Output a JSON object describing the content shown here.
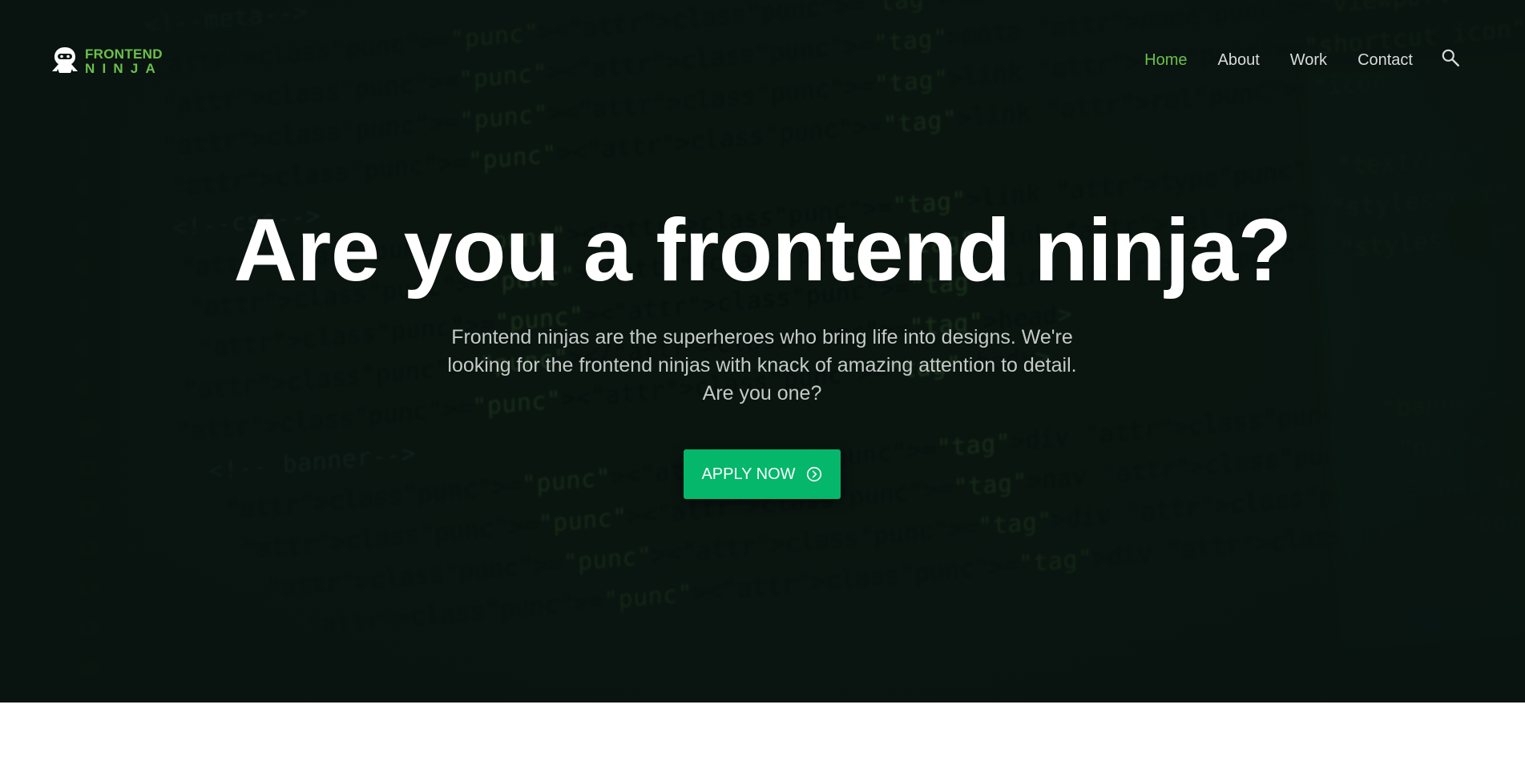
{
  "brand": {
    "line1": "FRONTEND",
    "line2": "NINJA",
    "accent_color": "#6cc04a"
  },
  "nav": {
    "items": [
      {
        "label": "Home",
        "active": true
      },
      {
        "label": "About",
        "active": false
      },
      {
        "label": "Work",
        "active": false
      },
      {
        "label": "Contact",
        "active": false
      }
    ],
    "search_icon": "search-icon"
  },
  "hero": {
    "title": "Are you a frontend ninja?",
    "subtitle": "Frontend ninjas are the superheroes who bring life into designs. We're looking for the frontend ninjas with knack of amazing attention to detail. Are you one?",
    "cta_label": "APPLY NOW",
    "cta_icon": "chevron-right-circle-icon",
    "cta_color": "#04b76a"
  },
  "background_code": [
    "<!--meta-->",
    "<title></title>",
    "<meta name=\"viewport\" content=\"width=device-width, initial-scale=1.0, maximum-scale=1.0, user-scalable=no\">",
    "<link rel=\"shortcut icon\" href=\"/favicon.ico\" type=\"image/x-icon\">",
    "<link rel=\"icon\" href=\"/favicon.ico\" type=\"image/x-icon\">",
    "<!--css-->",
    "<link type=\"text/css\" rel=\"stylesheet\" href=\"https://maxcdn.bootstrapcdn.com\">",
    "<link rel=\"stylesheet\" href=\"css/animate.css\">",
    "<link rel=\"stylesheet\" href=\"css/theme.css\">",
    "</head>",
    "<body>",
    "<!-- banner-->",
    "<div class=\"banner\">",
    "<nav class=\"nav\">",
    "<div class=\"nav-wrapper\">",
    "<div class=\"container\">"
  ]
}
